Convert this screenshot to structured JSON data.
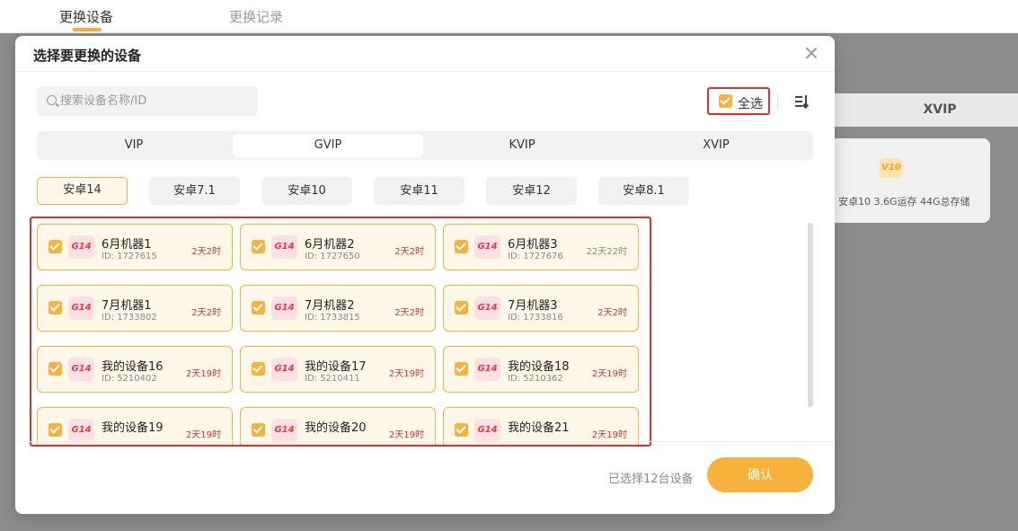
{
  "page_tabs": [
    {
      "label": "更换设备",
      "active": true
    },
    {
      "label": "更换记录",
      "active": false
    }
  ],
  "background": {
    "xvip_band_label": "XVIP",
    "card_logo": "V10",
    "card_text": "安卓10 3.6G运存 44G总存储"
  },
  "modal": {
    "title": "选择要更换的设备",
    "search_placeholder": "搜索设备名称/ID",
    "select_all_label": "全选",
    "select_all_checked": true,
    "tier_tabs": [
      {
        "label": "VIP",
        "active": false
      },
      {
        "label": "GVIP",
        "active": true
      },
      {
        "label": "KVIP",
        "active": false
      },
      {
        "label": "XVIP",
        "active": false
      }
    ],
    "os_tabs": [
      {
        "label": "安卓14",
        "active": true
      },
      {
        "label": "安卓7.1",
        "active": false
      },
      {
        "label": "安卓10",
        "active": false
      },
      {
        "label": "安卓11",
        "active": false
      },
      {
        "label": "安卓12",
        "active": false
      },
      {
        "label": "安卓8.1",
        "active": false
      }
    ],
    "devices": [
      {
        "logo": "G14",
        "name": "6月机器1",
        "id": "ID: 1727615",
        "time": "2天2时",
        "checked": true
      },
      {
        "logo": "G14",
        "name": "6月机器2",
        "id": "ID: 1727650",
        "time": "2天2时",
        "checked": true
      },
      {
        "logo": "G14",
        "name": "6月机器3",
        "id": "ID: 1727676",
        "time": "22天22时",
        "checked": true
      },
      {
        "logo": "G14",
        "name": "7月机器1",
        "id": "ID: 1733802",
        "time": "2天2时",
        "checked": true
      },
      {
        "logo": "G14",
        "name": "7月机器2",
        "id": "ID: 1733815",
        "time": "2天2时",
        "checked": true
      },
      {
        "logo": "G14",
        "name": "7月机器3",
        "id": "ID: 1733816",
        "time": "2天2时",
        "checked": true
      },
      {
        "logo": "G14",
        "name": "我的设备16",
        "id": "ID: 5210402",
        "time": "2天19时",
        "checked": true
      },
      {
        "logo": "G14",
        "name": "我的设备17",
        "id": "ID: 5210411",
        "time": "2天19时",
        "checked": true
      },
      {
        "logo": "G14",
        "name": "我的设备18",
        "id": "ID: 5210362",
        "time": "2天19时",
        "checked": true
      },
      {
        "logo": "G14",
        "name": "我的设备19",
        "id": "",
        "time": "2天19时",
        "checked": true
      },
      {
        "logo": "G14",
        "name": "我的设备20",
        "id": "",
        "time": "2天19时",
        "checked": true
      },
      {
        "logo": "G14",
        "name": "我的设备21",
        "id": "",
        "time": "2天19时",
        "checked": true
      }
    ],
    "selected_count_text": "已选择12台设备",
    "confirm_label": "确认"
  },
  "colors": {
    "accent": "#f7b13d",
    "highlight_border": "#e0332b",
    "time_red": "#e0332b"
  }
}
